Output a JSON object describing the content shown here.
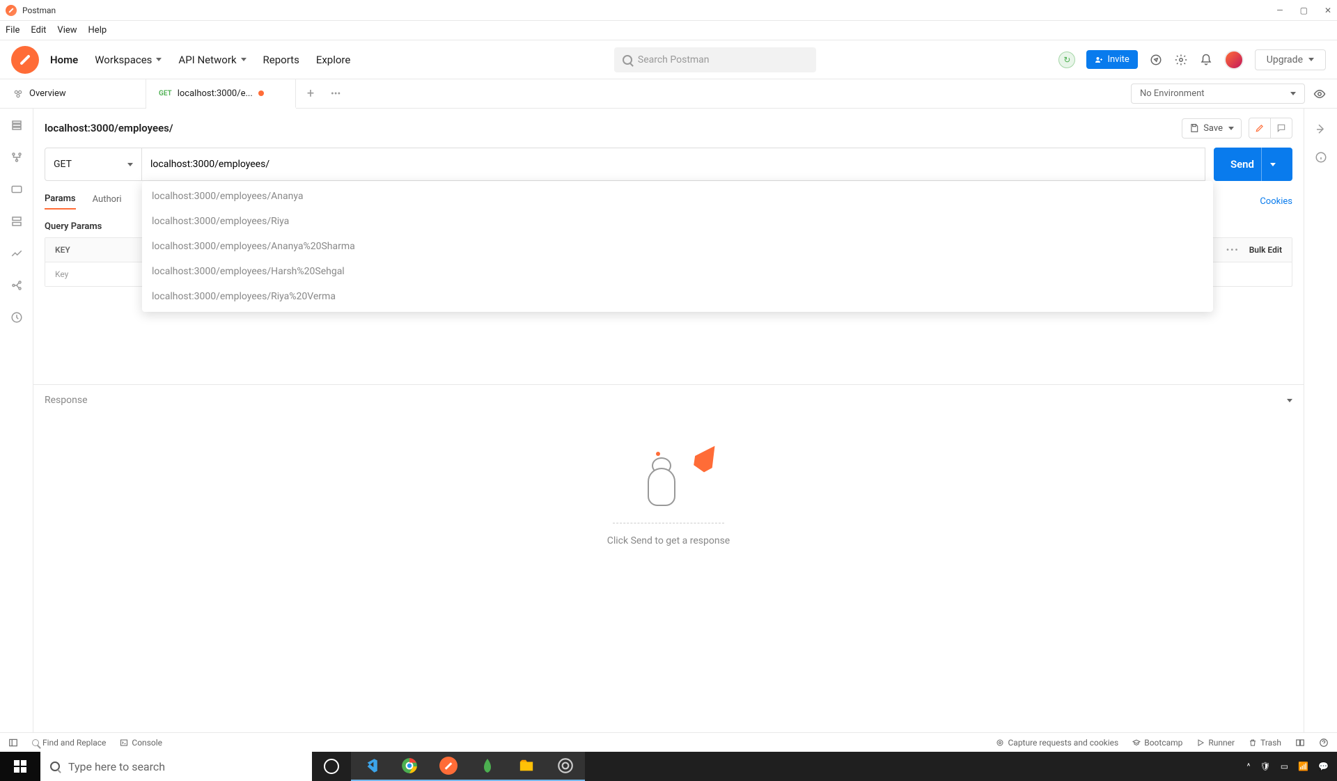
{
  "titlebar": {
    "app_name": "Postman"
  },
  "menubar": {
    "items": [
      "File",
      "Edit",
      "View",
      "Help"
    ]
  },
  "header": {
    "nav": {
      "home": "Home",
      "workspaces": "Workspaces",
      "api_network": "API Network",
      "reports": "Reports",
      "explore": "Explore"
    },
    "search_placeholder": "Search Postman",
    "invite": "Invite",
    "upgrade": "Upgrade"
  },
  "tabs": {
    "overview": "Overview",
    "request_method": "GET",
    "request_label": "localhost:3000/e...",
    "environment": "No Environment"
  },
  "request": {
    "title": "localhost:3000/employees/",
    "save": "Save",
    "method": "GET",
    "url": "localhost:3000/employees/",
    "send": "Send",
    "autocomplete": [
      "localhost:3000/employees/Ananya",
      "localhost:3000/employees/Riya",
      "localhost:3000/employees/Ananya%20Sharma",
      "localhost:3000/employees/Harsh%20Sehgal",
      "localhost:3000/employees/Riya%20Verma"
    ],
    "param_tabs": {
      "params": "Params",
      "auth": "Authori"
    },
    "cookies": "Cookies",
    "query_params_label": "Query Params",
    "table": {
      "key_header": "KEY",
      "bulk_edit": "Bulk Edit",
      "key_placeholder": "Key"
    }
  },
  "response": {
    "header": "Response",
    "empty_msg": "Click Send to get a response"
  },
  "statusbar": {
    "find": "Find and Replace",
    "console": "Console",
    "capture": "Capture requests and cookies",
    "bootcamp": "Bootcamp",
    "runner": "Runner",
    "trash": "Trash"
  },
  "taskbar": {
    "search_placeholder": "Type here to search"
  }
}
